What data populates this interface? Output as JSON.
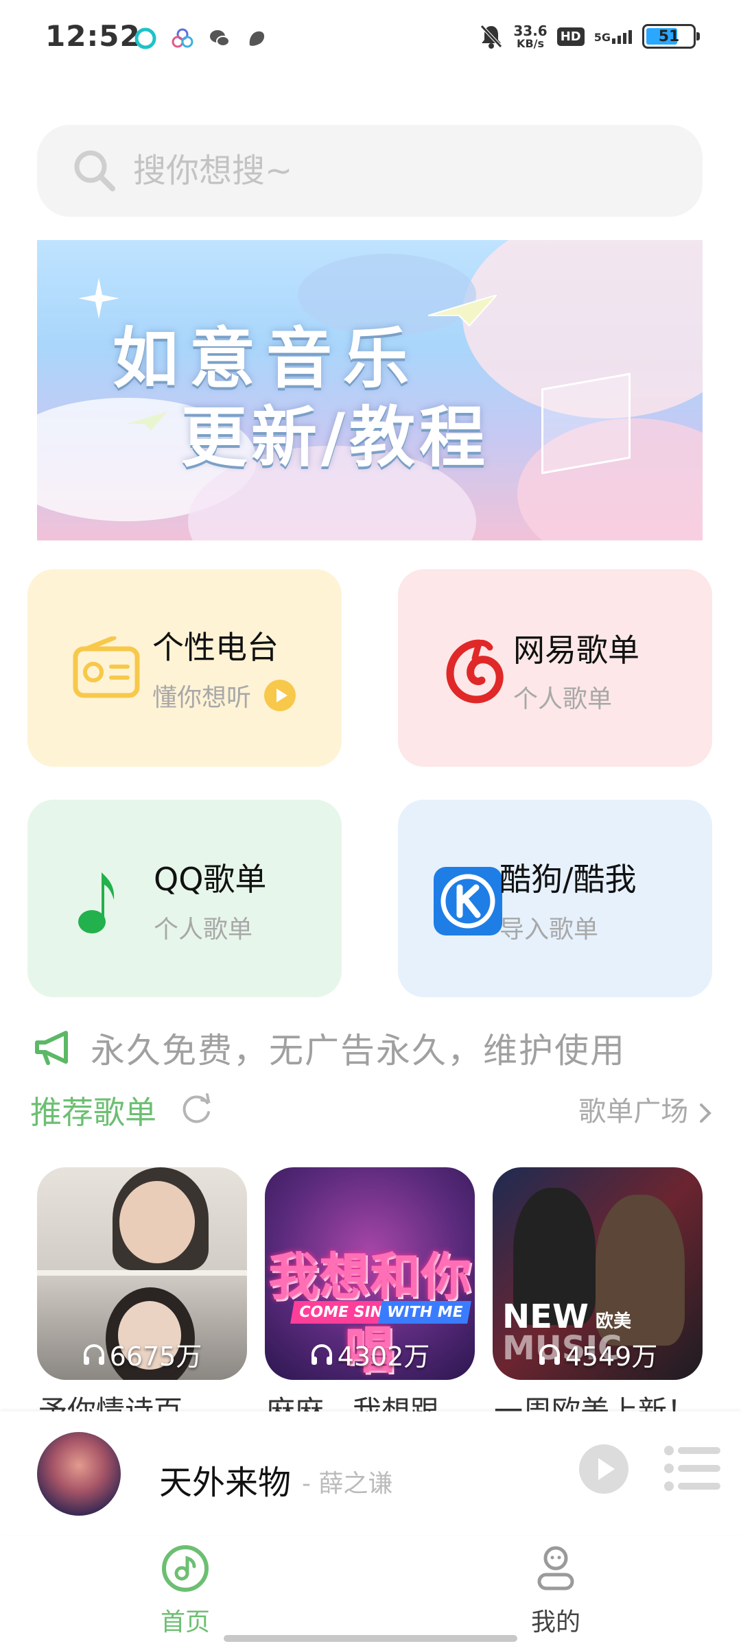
{
  "status_bar": {
    "time": "12:52",
    "net_speed_value": "33.6",
    "net_speed_unit": "KB/s",
    "hd": "HD",
    "network": "5G",
    "battery": "51"
  },
  "search": {
    "placeholder": "搜你想搜~"
  },
  "banner": {
    "title": "如意音乐",
    "subtitle": "更新/教程"
  },
  "features": {
    "radio": {
      "title": "个性电台",
      "subtitle": "懂你想听"
    },
    "netease": {
      "title": "网易歌单",
      "subtitle": "个人歌单"
    },
    "qq": {
      "title": "QQ歌单",
      "subtitle": "个人歌单"
    },
    "kugou": {
      "title": "酷狗/酷我",
      "subtitle": "导入歌单"
    }
  },
  "notice": "永久免费，无广告永久，维护使用",
  "recommend": {
    "title": "推荐歌单",
    "plaza": "歌单广场",
    "playlists": [
      {
        "count": "6675万",
        "name": "予你情诗百"
      },
      {
        "count": "4302万",
        "name": "麻麻，我想跟"
      },
      {
        "count": "4549万",
        "name": "一周欧美上新！"
      }
    ],
    "cover_text": {
      "brand": "NEW",
      "tag": "欧美",
      "music": "MUSIC",
      "show_cn": "我想和你唱",
      "show_en_1": "COME SING",
      "show_en_2": "WITH ME"
    }
  },
  "player": {
    "song": "天外来物",
    "artist": "- 薛之谦"
  },
  "nav": {
    "home": "首页",
    "mine": "我的"
  },
  "colors": {
    "accent_green": "#6cbf72",
    "radio_yellow": "#f7c84a",
    "netease_red": "#e02828",
    "qq_green": "#22b14c",
    "kugou_blue": "#1f7de6"
  }
}
